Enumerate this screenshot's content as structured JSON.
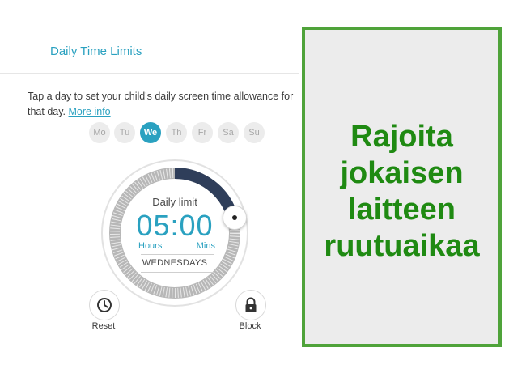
{
  "panel": {
    "title": "Daily Time Limits",
    "description": "Tap a day to set your child's daily screen time allowance for that day.",
    "more_info": "More info"
  },
  "days": [
    "Mo",
    "Tu",
    "We",
    "Th",
    "Fr",
    "Sa",
    "Su"
  ],
  "selected_day": "We",
  "dial": {
    "label": "Daily limit",
    "time": "05:00",
    "hours_label": "Hours",
    "mins_label": "Mins",
    "day_name": "WEDNESDAYS",
    "limit_fraction": 0.2083
  },
  "actions": {
    "reset": "Reset",
    "block": "Block"
  },
  "promo": {
    "line1": "Rajoita",
    "line2": "jokaisen",
    "line3": "laitteen",
    "line4": "ruutuaikaa"
  },
  "colors": {
    "accent": "#2aa1c0",
    "promo_green": "#1f8a12",
    "promo_border": "#4fa33a",
    "dial_dark": "#2f3e5a"
  }
}
